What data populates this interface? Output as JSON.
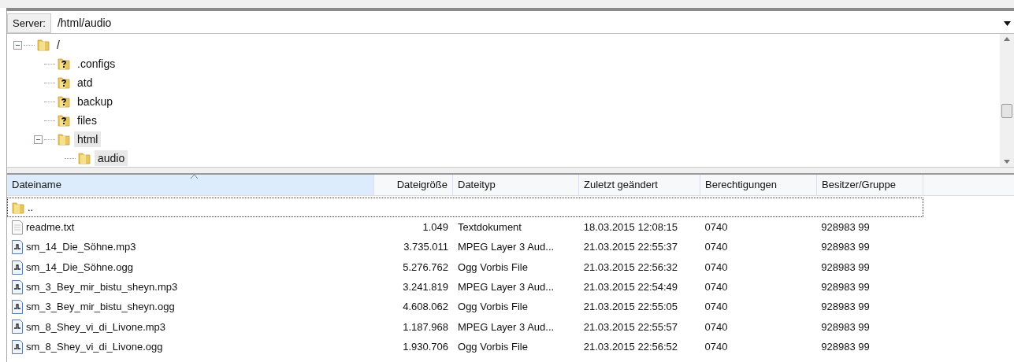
{
  "server_bar": {
    "label": "Server:",
    "path": "/html/audio"
  },
  "tree": [
    {
      "label": "/",
      "kind": "folder",
      "expanded": true,
      "selected": false,
      "children": [
        {
          "label": ".configs",
          "kind": "unknown",
          "selected": false
        },
        {
          "label": "atd",
          "kind": "unknown",
          "selected": false
        },
        {
          "label": "backup",
          "kind": "unknown",
          "selected": false
        },
        {
          "label": "files",
          "kind": "unknown",
          "selected": false
        },
        {
          "label": "html",
          "kind": "folder",
          "expanded": true,
          "selected": true,
          "children": [
            {
              "label": "audio",
              "kind": "folder",
              "selected": true
            }
          ]
        }
      ]
    }
  ],
  "table": {
    "columns": [
      {
        "label": "Dateiname",
        "sorted": true
      },
      {
        "label": "Dateigröße",
        "sorted": false
      },
      {
        "label": "Dateityp",
        "sorted": false
      },
      {
        "label": "Zuletzt geändert",
        "sorted": false
      },
      {
        "label": "Berechtigungen",
        "sorted": false
      },
      {
        "label": "Besitzer/Gruppe",
        "sorted": false
      }
    ],
    "rows": [
      {
        "kind": "folder",
        "focused": true,
        "cells": [
          ".."
        ]
      },
      {
        "kind": "text",
        "focused": false,
        "cells": [
          "readme.txt",
          "1.049",
          "Textdokument",
          "18.03.2015 12:08:15",
          "0740",
          "928983 99"
        ]
      },
      {
        "kind": "audio",
        "focused": false,
        "cells": [
          "sm_14_Die_Söhne.mp3",
          "3.735.011",
          "MPEG Layer 3 Aud...",
          "21.03.2015 22:55:37",
          "0740",
          "928983 99"
        ]
      },
      {
        "kind": "audio",
        "focused": false,
        "cells": [
          "sm_14_Die_Söhne.ogg",
          "5.276.762",
          "Ogg Vorbis File",
          "21.03.2015 22:56:32",
          "0740",
          "928983 99"
        ]
      },
      {
        "kind": "audio",
        "focused": false,
        "cells": [
          "sm_3_Bey_mir_bistu_sheyn.mp3",
          "3.241.819",
          "MPEG Layer 3 Aud...",
          "21.03.2015 22:54:49",
          "0740",
          "928983 99"
        ]
      },
      {
        "kind": "audio",
        "focused": false,
        "cells": [
          "sm_3_Bey_mir_bistu_sheyn.ogg",
          "4.608.062",
          "Ogg Vorbis File",
          "21.03.2015 22:55:05",
          "0740",
          "928983 99"
        ]
      },
      {
        "kind": "audio",
        "focused": false,
        "cells": [
          "sm_8_Shey_vi_di_Livone.mp3",
          "1.187.968",
          "MPEG Layer 3 Aud...",
          "21.03.2015 22:55:57",
          "0740",
          "928983 99"
        ]
      },
      {
        "kind": "audio",
        "focused": false,
        "cells": [
          "sm_8_Shey_vi_di_Livone.ogg",
          "1.930.706",
          "Ogg Vorbis File",
          "21.03.2015 22:56:52",
          "0740",
          "928983 99"
        ]
      }
    ]
  }
}
